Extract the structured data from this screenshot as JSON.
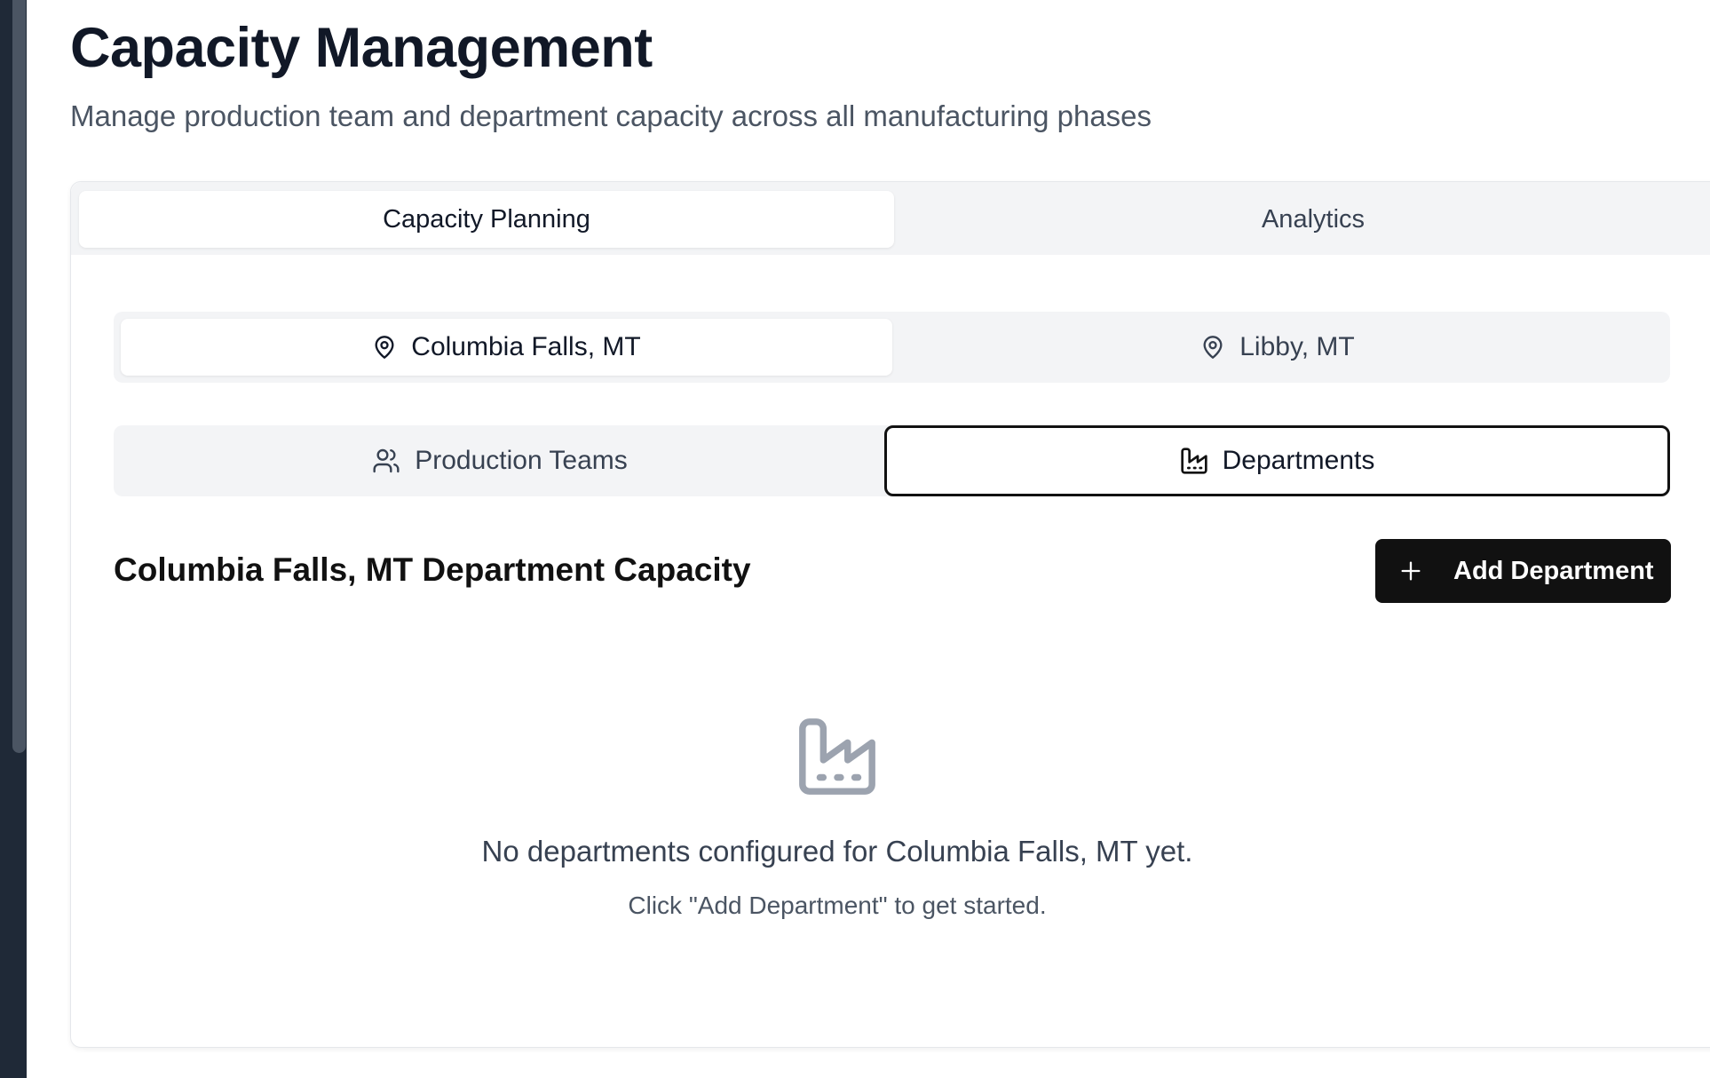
{
  "page": {
    "title": "Capacity Management",
    "subtitle": "Manage production team and department capacity across all manufacturing phases"
  },
  "main_tabs": [
    {
      "label": "Capacity Planning",
      "active": true
    },
    {
      "label": "Analytics",
      "active": false
    }
  ],
  "locations": [
    {
      "label": "Columbia Falls, MT",
      "icon": "map-pin-icon",
      "active": true
    },
    {
      "label": "Libby, MT",
      "icon": "map-pin-icon",
      "active": false
    }
  ],
  "views": [
    {
      "label": "Production Teams",
      "icon": "users-icon",
      "active": false
    },
    {
      "label": "Departments",
      "icon": "factory-icon",
      "active": true
    }
  ],
  "section": {
    "title": "Columbia Falls, MT Department Capacity",
    "add_button_label": "Add Department",
    "add_button_icon": "plus-icon"
  },
  "empty_state": {
    "icon": "factory-icon",
    "message": "No departments configured for Columbia Falls, MT yet.",
    "hint": "Click \"Add Department\" to get started."
  },
  "colors": {
    "primary_button": "#111111",
    "tab_background": "#f3f4f6",
    "muted_text": "#4b5563",
    "empty_icon": "#9ca3af"
  }
}
